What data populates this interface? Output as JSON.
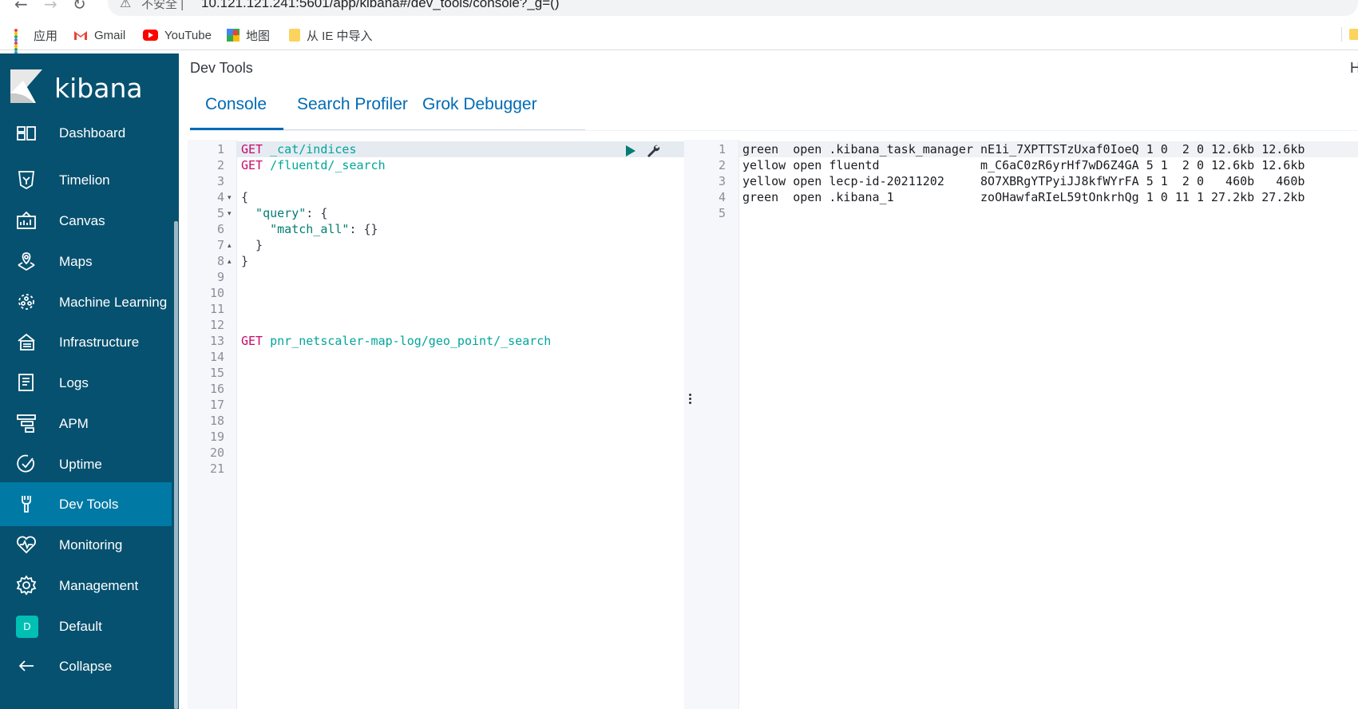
{
  "browser": {
    "security_label": "不安全",
    "separator": "|",
    "url": "10.121.121.241:5601/app/kibana#/dev_tools/console?_g=()",
    "bookmarks": [
      {
        "label": "应用"
      },
      {
        "label": "Gmail"
      },
      {
        "label": "YouTube"
      },
      {
        "label": "地图"
      },
      {
        "label": "从 IE 中导入"
      }
    ]
  },
  "sidebar": {
    "logo": "kibana",
    "items": [
      {
        "label": "Dashboard",
        "icon": "dashboard-icon"
      },
      {
        "label": "Timelion",
        "icon": "timelion-icon"
      },
      {
        "label": "Canvas",
        "icon": "canvas-icon"
      },
      {
        "label": "Maps",
        "icon": "maps-icon"
      },
      {
        "label": "Machine Learning",
        "icon": "machine-learning-icon"
      },
      {
        "label": "Infrastructure",
        "icon": "infrastructure-icon"
      },
      {
        "label": "Logs",
        "icon": "logs-icon"
      },
      {
        "label": "APM",
        "icon": "apm-icon"
      },
      {
        "label": "Uptime",
        "icon": "uptime-icon"
      },
      {
        "label": "Dev Tools",
        "icon": "dev-tools-icon",
        "active": true
      },
      {
        "label": "Monitoring",
        "icon": "monitoring-icon"
      },
      {
        "label": "Management",
        "icon": "gear-icon"
      },
      {
        "label": "Default",
        "icon": "space-avatar",
        "avatar_letter": "D"
      },
      {
        "label": "Collapse",
        "icon": "arrow-left-icon"
      }
    ]
  },
  "header": {
    "title": "Dev Tools",
    "cut_text": "H"
  },
  "tabs": [
    {
      "label": "Console",
      "active": true
    },
    {
      "label": "Search Profiler"
    },
    {
      "label": "Grok Debugger"
    }
  ],
  "editor": {
    "line_numbers": [
      "1",
      "2",
      "3",
      "4",
      "5",
      "6",
      "7",
      "8",
      "9",
      "10",
      "11",
      "12",
      "13",
      "14",
      "15",
      "16",
      "17",
      "18",
      "19",
      "20",
      "21"
    ],
    "lines": {
      "l1_method": "GET",
      "l1_path": " _cat/indices",
      "l2_method": "GET",
      "l2_path": " /fluentd/_search",
      "l4": "{",
      "l5_key": "  \"query\"",
      "l5_rest": ": {",
      "l6_key": "    \"match_all\"",
      "l6_rest": ": {}",
      "l7": "  }",
      "l8": "}",
      "l13_method": "GET",
      "l13_path": " pnr_netscaler-map-log/geo_point/_search"
    }
  },
  "output": {
    "line_numbers": [
      "1",
      "2",
      "3",
      "4",
      "5"
    ],
    "lines": [
      "green  open .kibana_task_manager nE1i_7XPTTSTzUxaf0IoeQ 1 0  2 0 12.6kb 12.6kb",
      "yellow open fluentd              m_C6aC0zR6yrHf7wD6Z4GA 5 1  2 0 12.6kb 12.6kb",
      "yellow open lecp-id-20211202     8O7XBRgYTPyiJJ8kfWYrFA 5 1  2 0   460b   460b",
      "green  open .kibana_1            zoOHawfaRIeL59tOnkrhQg 1 0 11 1 27.2kb 27.2kb",
      ""
    ]
  },
  "colors": {
    "sidebar_bg": "#06516f",
    "sidebar_active": "#0079a5",
    "tab_blue": "#006bb4",
    "method_pink": "#c80a68",
    "path_teal": "#00a69b"
  }
}
